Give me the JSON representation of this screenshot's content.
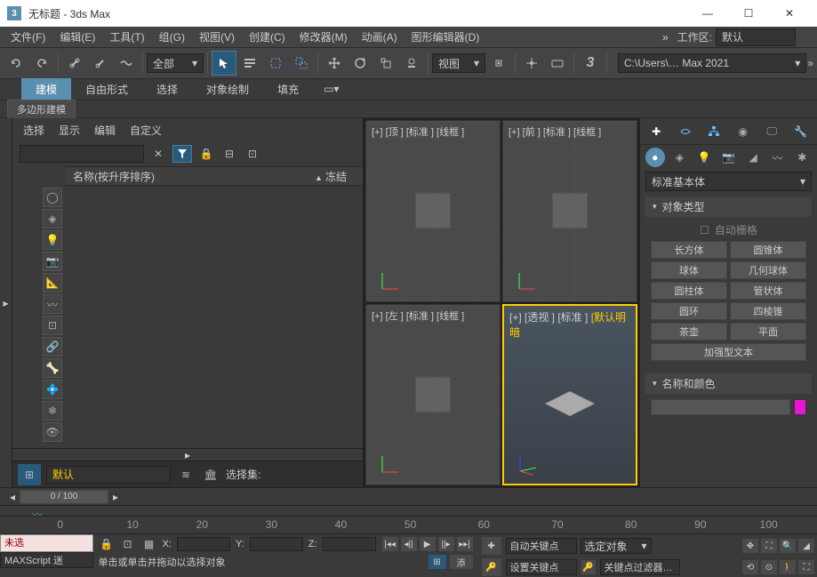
{
  "title": "无标题 - 3ds Max",
  "menubar": [
    "文件(F)",
    "编辑(E)",
    "工具(T)",
    "组(G)",
    "视图(V)",
    "创建(C)",
    "修改器(M)",
    "动画(A)",
    "图形编辑器(D)"
  ],
  "workspace_label": "工作区:",
  "workspace_value": "默认",
  "toolbar": {
    "filter": "全部",
    "coordsys": "视图",
    "path": "C:\\Users\\… Max 2021"
  },
  "ribbon": {
    "tabs": [
      "建模",
      "自由形式",
      "选择",
      "对象绘制",
      "填充"
    ],
    "subtab": "多边形建模"
  },
  "explorer": {
    "head": [
      "选择",
      "显示",
      "编辑",
      "自定义"
    ],
    "col1": "名称(按升序排序)",
    "col2": "冻结",
    "bottom_drop": "默认",
    "sel_set_label": "选择集:"
  },
  "viewports": {
    "tl": "[+] [顶 ] [标准 ] [线框 ]",
    "tr": "[+] [前 ] [标准 ] [线框 ]",
    "bl": "[+] [左 ] [标准 ] [线框 ]",
    "br_a": "[+] [透视 ] [标准 ] ",
    "br_b": "[默认明暗"
  },
  "cmdpanel": {
    "dropdown": "标准基本体",
    "rollup1": "对象类型",
    "autogrid": "自动栅格",
    "buttons": [
      "长方体",
      "圆锥体",
      "球体",
      "几何球体",
      "圆柱体",
      "管状体",
      "圆环",
      "四棱锥",
      "茶壶",
      "平面"
    ],
    "reinforced": "加强型文本",
    "rollup2": "名称和颜色"
  },
  "timeline": {
    "thumb": "0 / 100",
    "ticks": [
      0,
      10,
      20,
      30,
      40,
      50,
      60,
      70,
      80,
      90,
      100
    ]
  },
  "status": {
    "listener": "未选",
    "maxscript": "MAXScript 迷",
    "x": "X:",
    "y": "Y:",
    "z": "Z:",
    "tooltip": "单击或单击并拖动以选择对象",
    "addtime": "添",
    "autokey": "自动关键点",
    "selkey": "选定对象",
    "setkey": "设置关键点",
    "filter": "关键点过滤器…"
  }
}
